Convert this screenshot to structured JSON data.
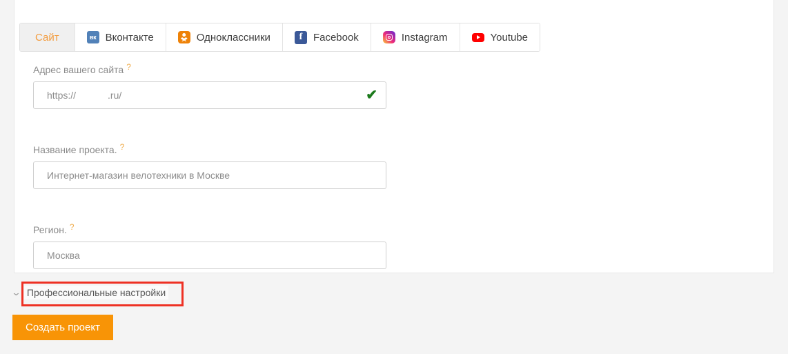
{
  "tabs": [
    {
      "label": "Сайт",
      "icon": null,
      "active": true
    },
    {
      "label": "Вконтакте",
      "icon": "vk-icon",
      "icon_text": "вк",
      "active": false
    },
    {
      "label": "Одноклассники",
      "icon": "odnoklassniki-icon",
      "active": false
    },
    {
      "label": "Facebook",
      "icon": "facebook-icon",
      "icon_text": "f",
      "active": false
    },
    {
      "label": "Instagram",
      "icon": "instagram-icon",
      "active": false
    },
    {
      "label": "Youtube",
      "icon": "youtube-icon",
      "active": false
    }
  ],
  "form": {
    "site_url": {
      "label": "Адрес вашего сайта",
      "help": "?",
      "value_prefix": "https://",
      "value_suffix": ".ru/",
      "valid_icon": "✔",
      "valid": true
    },
    "project_name": {
      "label": "Название проекта.",
      "help": "?",
      "value": "Интернет-магазин велотехники в Москве"
    },
    "region": {
      "label": "Регион.",
      "help": "?",
      "value": "Москва"
    }
  },
  "professional_settings": {
    "chevron": "⌄",
    "label": "Профессиональные настройки"
  },
  "create_button": {
    "label": "Создать проект"
  },
  "colors": {
    "accent_orange": "#f89406",
    "active_tab_text": "#f39b3c",
    "help_mark": "#f0ad4e",
    "valid_green": "#1c7a1c",
    "annotation_red": "#ee3124",
    "page_background": "#f4f4f4",
    "card_background": "#ffffff"
  }
}
